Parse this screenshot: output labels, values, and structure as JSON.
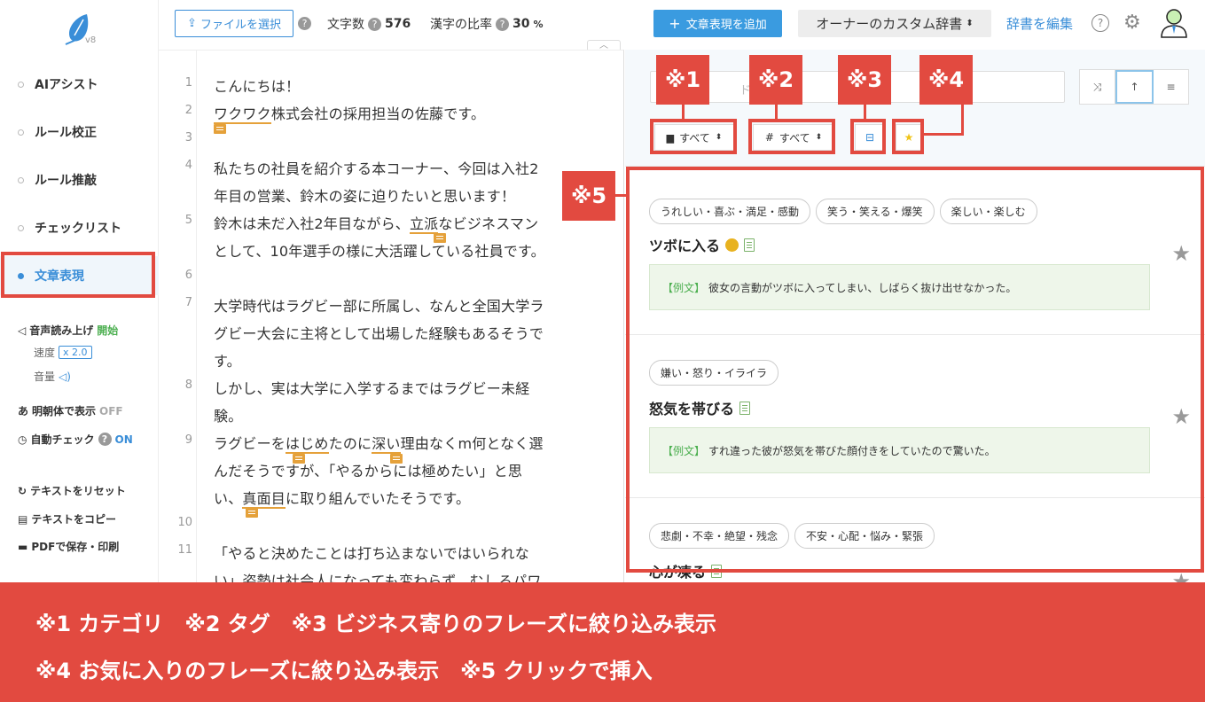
{
  "sidebar": {
    "logo_version": "v8",
    "nav": [
      {
        "label": "AIアシスト"
      },
      {
        "label": "ルール校正"
      },
      {
        "label": "ルール推敲"
      },
      {
        "label": "チェックリスト"
      },
      {
        "label": "文章表現"
      }
    ],
    "tts_label": "音声読み上げ",
    "tts_start": "開始",
    "speed_label": "速度",
    "speed_value": "x 2.0",
    "volume_label": "音量",
    "mincho_label": "明朝体で表示",
    "mincho_value": "OFF",
    "auto_check_label": "自動チェック",
    "auto_check_value": "ON",
    "reset_label": "テキストをリセット",
    "copy_label": "テキストをコピー",
    "pdf_label": "PDFで保存・印刷"
  },
  "toolbar": {
    "file_button": "ファイルを選択",
    "char_count_label": "文字数",
    "char_count": "576",
    "kanji_label": "漢字の比率",
    "kanji_ratio": "30",
    "kanji_unit": "%",
    "add_expression": "文章表現を追加",
    "dict_select": "オーナーのカスタム辞書",
    "edit_dict": "辞書を編集"
  },
  "editor": {
    "lines": [
      {
        "n": "1",
        "text": "こんにちは！"
      },
      {
        "n": "2",
        "pre": "",
        "u": "ワクワク",
        "post": "株式会社の採用担当の佐藤です。"
      },
      {
        "n": "3",
        "text": ""
      },
      {
        "n": "4",
        "text": "私たちの社員を紹介する本コーナー、今回は入社2"
      },
      {
        "n": "",
        "text": "年目の営業、鈴木の姿に迫りたいと思います！"
      },
      {
        "n": "5",
        "pre": "鈴木は未だ入社2年目ながら、",
        "u": "立派",
        "post": "なビジネスマン"
      },
      {
        "n": "",
        "text": "として、10年選手の様に大活躍している社員です。"
      },
      {
        "n": "6",
        "text": ""
      },
      {
        "n": "7",
        "text": "大学時代はラグビー部に所属し、なんと全国大学ラ"
      },
      {
        "n": "",
        "text": "グビー大会に主将として出場した経験もあるそうで"
      },
      {
        "n": "",
        "text": "す。"
      },
      {
        "n": "8",
        "text": "しかし、実は大学に入学するまではラグビー未経"
      },
      {
        "n": "",
        "text": "験。"
      },
      {
        "n": "9",
        "pre": "ラグビーを",
        "u": "はじめ",
        "mid": "たのに",
        "u2": "深い",
        "post": "理由なくm何となく選"
      },
      {
        "n": "",
        "text": "んだそうですが、「やるからには極めたい」と思"
      },
      {
        "n": "",
        "pre": "い、",
        "u": "真面目",
        "post": "に取り組んでいたそうです。"
      },
      {
        "n": "10",
        "text": ""
      },
      {
        "n": "11",
        "text": "「やると決めたことは打ち込まないではいられな"
      },
      {
        "n": "",
        "text": "い」姿勢は社会人になっても変わらず、むしろパワ"
      }
    ]
  },
  "panel": {
    "search_placeholder": "ドで検",
    "filter_category": "すべて",
    "filter_tag": "すべて",
    "cards": [
      {
        "tags": [
          "うれしい・喜ぶ・満足・感動",
          "笑う・笑える・爆笑",
          "楽しい・楽しむ"
        ],
        "phrase": "ツボに入る",
        "example_label": "【例文】",
        "example": "彼女の言動がツボに入ってしまい、しばらく抜け出せなかった。"
      },
      {
        "tags": [
          "嫌い・怒り・イライラ"
        ],
        "phrase": "怒気を帯びる",
        "example_label": "【例文】",
        "example": "すれ違った彼が怒気を帯びた顔付きをしていたので驚いた。"
      },
      {
        "tags": [
          "悲劇・不幸・絶望・残念",
          "不安・心配・悩み・緊張"
        ],
        "phrase": "心が凍る"
      }
    ]
  },
  "annotations": {
    "m1": "※1",
    "m2": "※2",
    "m3": "※3",
    "m4": "※4",
    "m5": "※5"
  },
  "banner": {
    "line1": "※1 カテゴリ　※2 タグ　※3 ビジネス寄りのフレーズに絞り込み表示",
    "line2": "※4 お気に入りのフレーズに絞り込み表示　※5 クリックで挿入"
  },
  "colors": {
    "accent": "#3a8ed8",
    "annotation_red": "#e24a40",
    "underline": "#e5a13a"
  }
}
